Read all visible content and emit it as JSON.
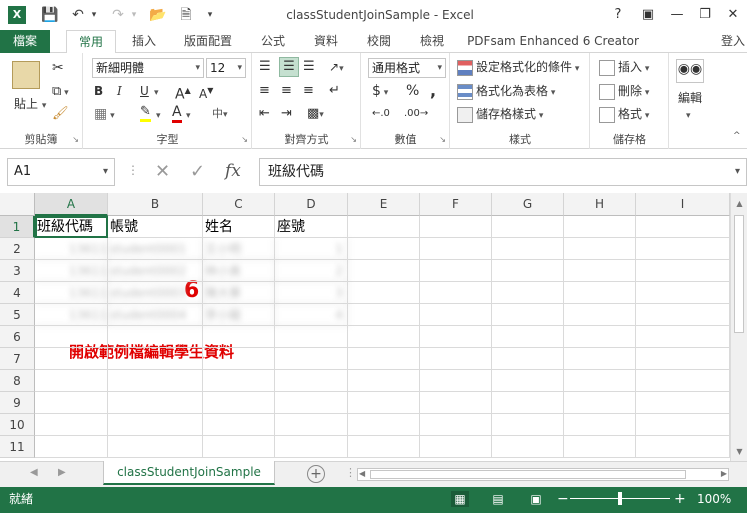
{
  "app": {
    "logo_letter": "X",
    "window_title": "classStudentJoinSample - Excel",
    "help": "?",
    "signin": "登入"
  },
  "ribbon_tabs": [
    "檔案",
    "常用",
    "插入",
    "版面配置",
    "公式",
    "資料",
    "校閱",
    "檢視",
    "PDFsam Enhanced 6 Creator"
  ],
  "ribbon": {
    "clipboard": {
      "paste": "貼上",
      "label": "剪貼簿"
    },
    "font": {
      "name": "新細明體",
      "size": "12",
      "bold": "B",
      "italic": "I",
      "underline": "U",
      "label": "字型"
    },
    "alignment": {
      "label": "對齊方式"
    },
    "number": {
      "format": "通用格式",
      "currency": "$",
      "percent": "%",
      "comma": ",",
      "label": "數值"
    },
    "styles": {
      "conditional": "設定格式化的條件",
      "table": "格式化為表格",
      "cell": "儲存格樣式",
      "label": "樣式"
    },
    "cells": {
      "insert": "插入",
      "delete": "刪除",
      "format": "格式",
      "label": "儲存格"
    },
    "editing": {
      "label": "編輯"
    }
  },
  "formula_bar": {
    "name_box": "A1",
    "fx": "fx",
    "value": "班級代碼"
  },
  "columns": [
    "A",
    "B",
    "C",
    "D",
    "E",
    "F",
    "G",
    "H",
    "I"
  ],
  "rows": [
    "1",
    "2",
    "3",
    "4",
    "5",
    "6",
    "7",
    "8",
    "9",
    "10",
    "11"
  ],
  "cells": {
    "A1": "班級代碼",
    "B1": "帳號",
    "C1": "姓名",
    "D1": "座號"
  },
  "blurred_rows": [
    {
      "a": "13611",
      "b": "student0001",
      "c": "王小明",
      "d": "1"
    },
    {
      "a": "13611",
      "b": "student0002",
      "c": "林小美",
      "d": "2"
    },
    {
      "a": "13611",
      "b": "student0003",
      "c": "陳大華",
      "d": "3"
    },
    {
      "a": "13611",
      "b": "student0004",
      "c": "李小龍",
      "d": "4"
    }
  ],
  "annotations": {
    "step_number": "6",
    "step_text": "開啟範例檔編輯學生資料"
  },
  "sheet_tabs": [
    "classStudentJoinSample"
  ],
  "status": {
    "ready": "就緒",
    "zoom_minus": "−",
    "zoom_plus": "+",
    "zoom": "100%"
  },
  "colors": {
    "accent": "#217346",
    "annotation": "#e00000"
  }
}
